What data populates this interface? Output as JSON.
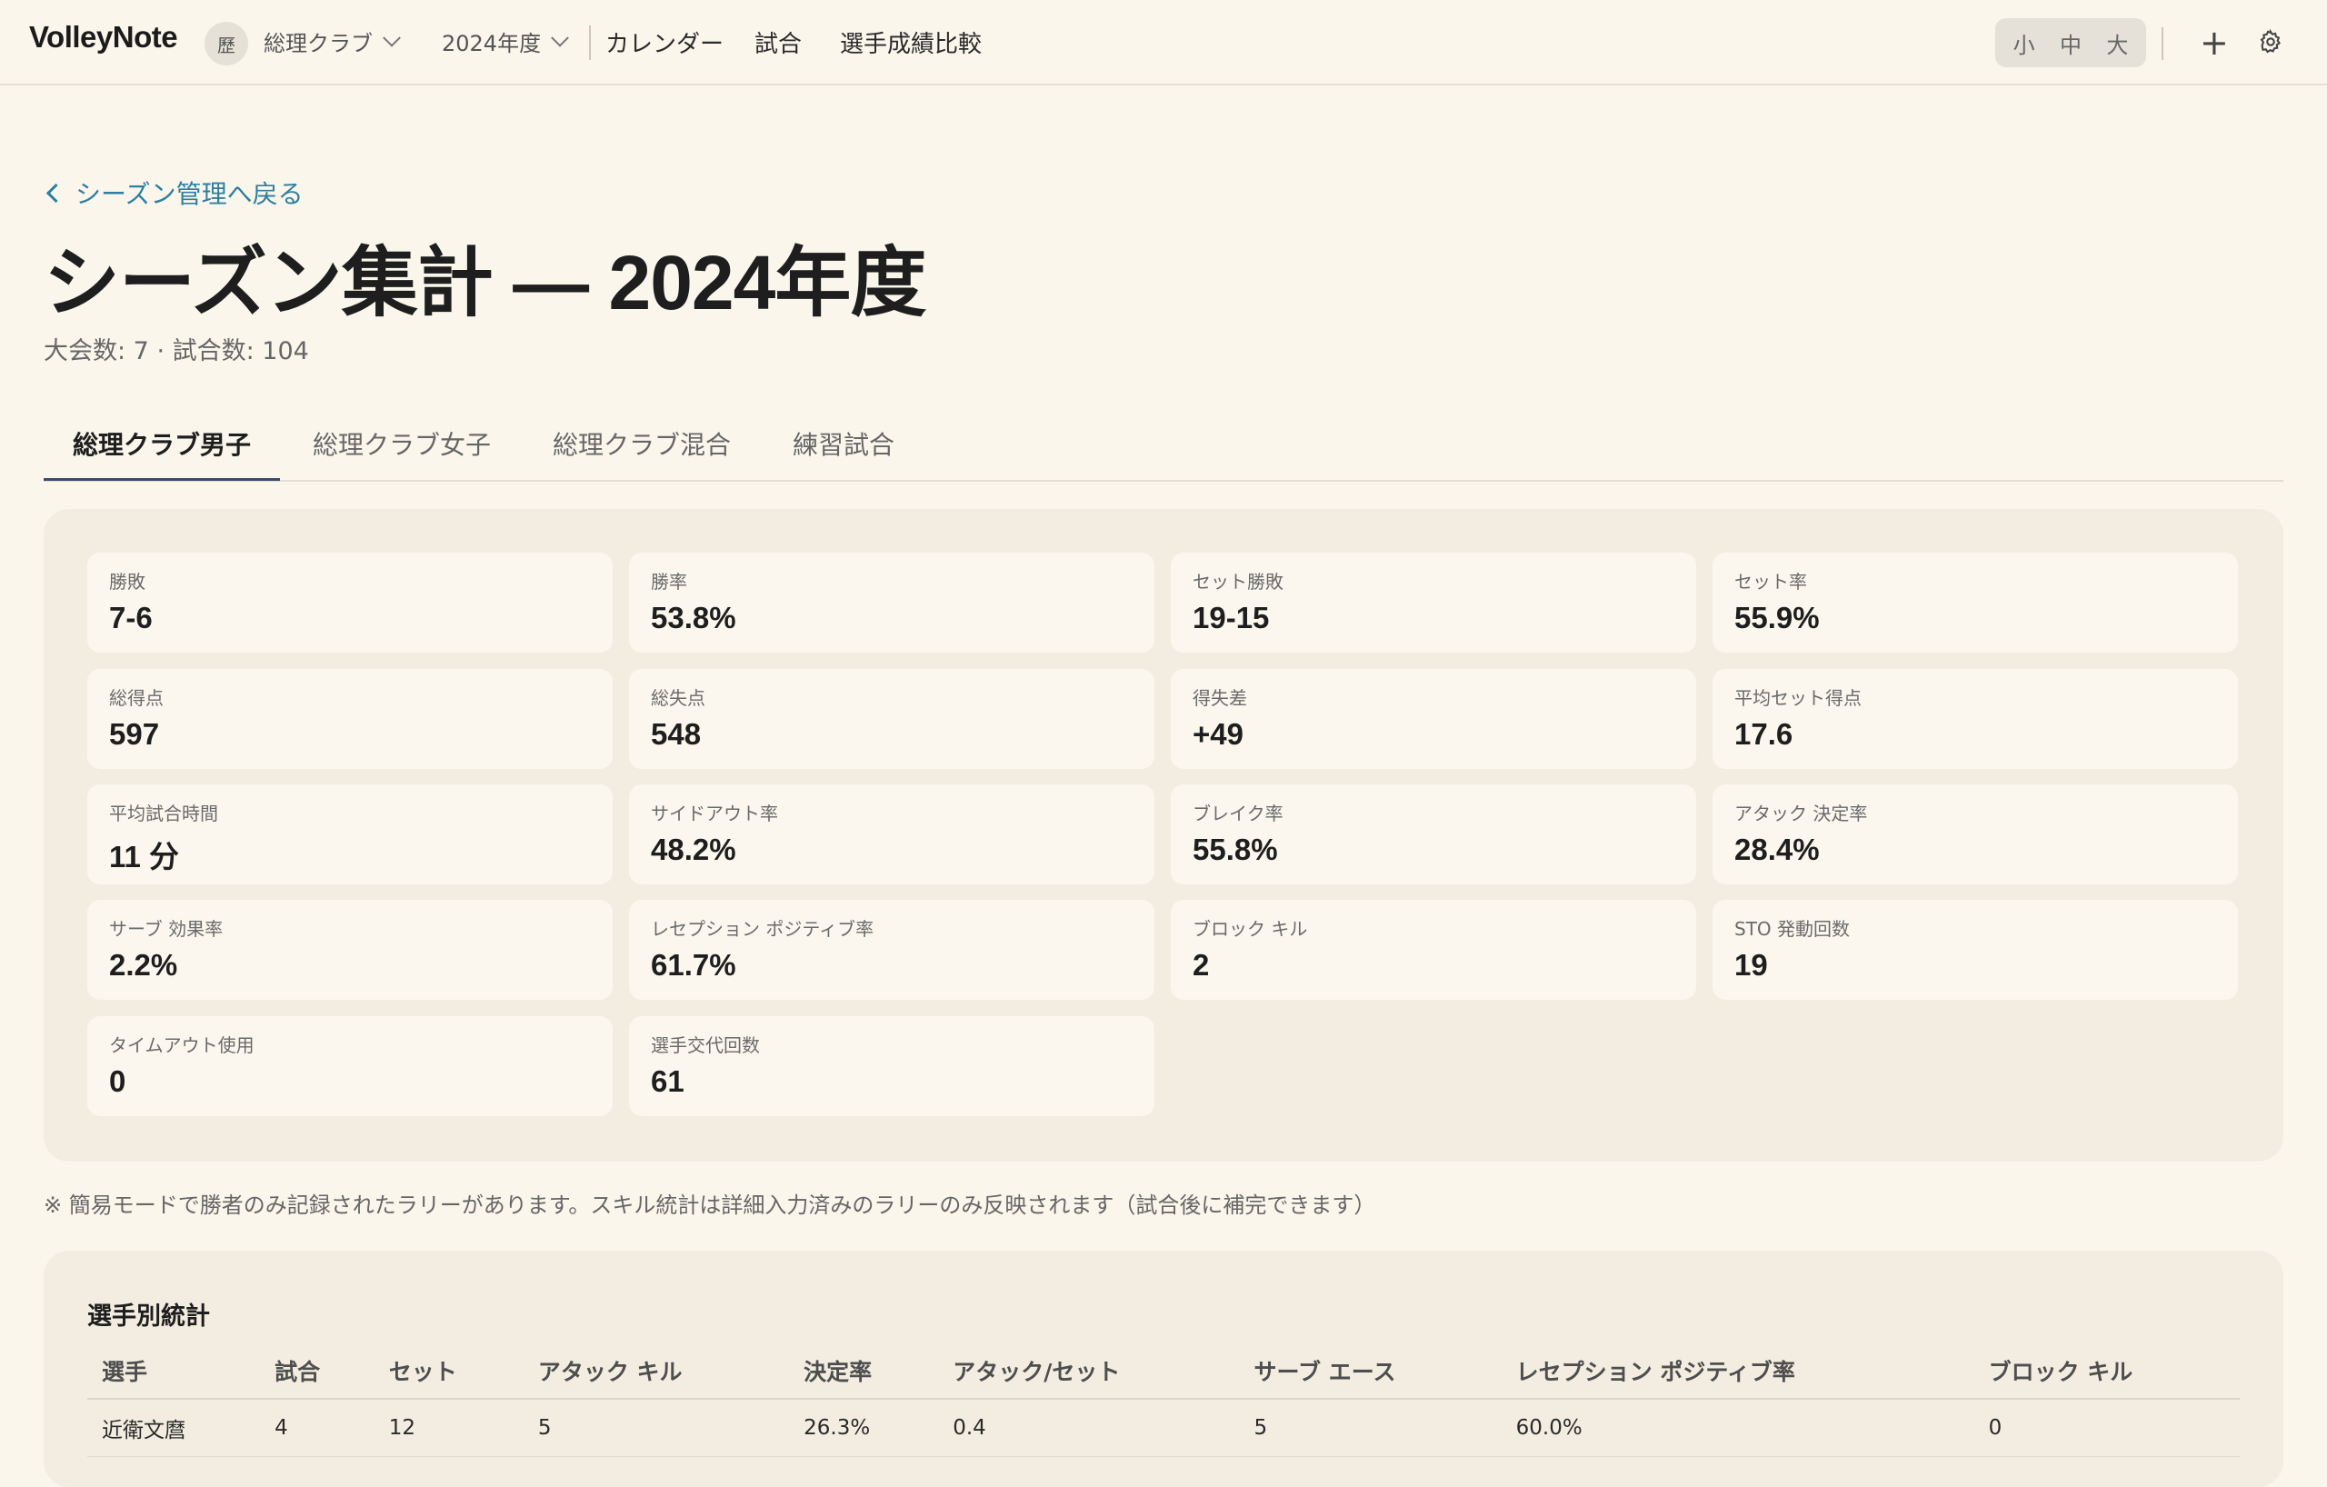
{
  "app": {
    "brand": "VolleyNote",
    "club_chip": "歷",
    "club_select": "総理クラブ",
    "year_select": "2024年度",
    "nav": [
      "カレンダー",
      "試合",
      "選手成績比較"
    ],
    "size_options": [
      "小",
      "中",
      "大"
    ],
    "icons": [
      "chevron-down-icon",
      "plus-icon",
      "gear-icon",
      "chevron-left-icon"
    ]
  },
  "page": {
    "back_link": "シーズン管理へ戻る",
    "title": "シーズン集計 — 2024年度",
    "subtitle": "大会数: 7 · 試合数: 104"
  },
  "tabs": [
    {
      "label": "総理クラブ男子",
      "active": true
    },
    {
      "label": "総理クラブ女子",
      "active": false
    },
    {
      "label": "総理クラブ混合",
      "active": false
    },
    {
      "label": "練習試合",
      "active": false
    }
  ],
  "stats": [
    {
      "label": "勝敗",
      "value": "7-6"
    },
    {
      "label": "勝率",
      "value": "53.8%"
    },
    {
      "label": "セット勝敗",
      "value": "19-15"
    },
    {
      "label": "セット率",
      "value": "55.9%"
    },
    {
      "label": "総得点",
      "value": "597"
    },
    {
      "label": "総失点",
      "value": "548"
    },
    {
      "label": "得失差",
      "value": "+49"
    },
    {
      "label": "平均セット得点",
      "value": "17.6"
    },
    {
      "label": "平均試合時間",
      "value": "11 分"
    },
    {
      "label": "サイドアウト率",
      "value": "48.2%"
    },
    {
      "label": "ブレイク率",
      "value": "55.8%"
    },
    {
      "label": "アタック 決定率",
      "value": "28.4%"
    },
    {
      "label": "サーブ 効果率",
      "value": "2.2%"
    },
    {
      "label": "レセプション ポジティブ率",
      "value": "61.7%"
    },
    {
      "label": "ブロック キル",
      "value": "2"
    },
    {
      "label": "STO 発動回数",
      "value": "19"
    },
    {
      "label": "タイムアウト使用",
      "value": "0"
    },
    {
      "label": "選手交代回数",
      "value": "61"
    }
  ],
  "note": "※ 簡易モードで勝者のみ記録されたラリーがあります。スキル統計は詳細入力済みのラリーのみ反映されます（試合後に補完できます）",
  "players": {
    "title": "選手別統計",
    "columns": [
      "選手",
      "試合",
      "セット",
      "アタック キル",
      "決定率",
      "アタック/セット",
      "サーブ エース",
      "レセプション ポジティブ率",
      "ブロック キル"
    ],
    "rows": [
      [
        "近衛文麿",
        "4",
        "12",
        "5",
        "26.3%",
        "0.4",
        "5",
        "60.0%",
        "0"
      ]
    ]
  }
}
